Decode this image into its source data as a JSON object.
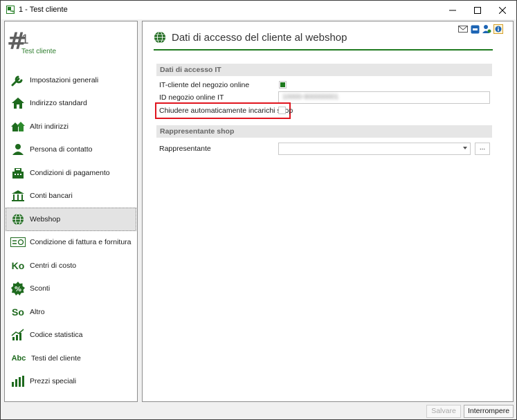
{
  "window": {
    "title": "1 - Test cliente"
  },
  "client": {
    "hash": "#",
    "number": "1",
    "name": "Test cliente"
  },
  "nav": {
    "items": [
      {
        "label": "Impostazioni generali",
        "icon": "wrench-icon",
        "active": false
      },
      {
        "label": "Indirizzo standard",
        "icon": "house-icon",
        "active": false
      },
      {
        "label": "Altri indirizzi",
        "icon": "houses-icon",
        "active": false
      },
      {
        "label": "Persona di contatto",
        "icon": "person-icon",
        "active": false
      },
      {
        "label": "Condizioni di pagamento",
        "icon": "cash-register-icon",
        "active": false
      },
      {
        "label": "Conti bancari",
        "icon": "bank-icon",
        "active": false
      },
      {
        "label": "Webshop",
        "icon": "globe-icon",
        "active": true
      },
      {
        "label": "Condizione di fattura e fornitura",
        "icon": "invoice-icon",
        "active": false
      },
      {
        "label": "Centri di costo",
        "icon": "ko-icon",
        "glyph": "Ko",
        "active": false
      },
      {
        "label": "Sconti",
        "icon": "percent-icon",
        "active": false
      },
      {
        "label": "Altro",
        "icon": "so-icon",
        "glyph": "So",
        "active": false
      },
      {
        "label": "Codice statistica",
        "icon": "trend-chart-icon",
        "active": false
      },
      {
        "label": "Testi del cliente",
        "icon": "abc-icon",
        "glyph": "Abc",
        "active": false
      },
      {
        "label": "Prezzi speciali",
        "icon": "bar-chart-icon",
        "active": false
      }
    ]
  },
  "main": {
    "title": "Dati di accesso del cliente al webshop",
    "section1": {
      "heading": "Dati di accesso IT",
      "online_customer_label": "IT-cliente del negozio online",
      "online_customer_checked": true,
      "shop_id_label": "ID negozio online IT",
      "shop_id_value": "10000-900000001",
      "auto_close_label": "Chiudere automaticamente incarichi shop",
      "auto_close_checked": false
    },
    "section2": {
      "heading": "Rappresentante shop",
      "rep_label": "Rappresentante",
      "rep_value": "",
      "browse_label": "..."
    }
  },
  "buttons": {
    "save": "Salvare",
    "abort": "Interrompere"
  },
  "colors": {
    "accent": "#1e7a1e",
    "highlight": "#e0141e"
  }
}
